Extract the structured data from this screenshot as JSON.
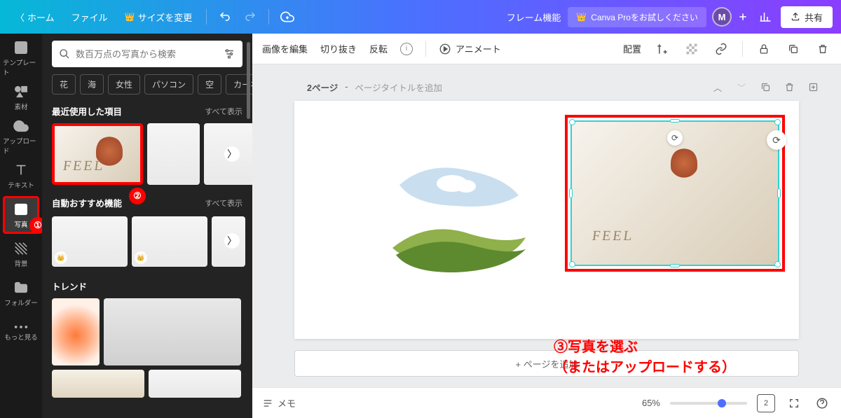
{
  "topbar": {
    "home": "ホーム",
    "file": "ファイル",
    "resize": "サイズを変更",
    "title": "フレーム機能",
    "pro": "Canva Proをお試しください",
    "avatar": "M",
    "share": "共有"
  },
  "rail": {
    "items": [
      {
        "id": "template",
        "label": "テンプレート"
      },
      {
        "id": "elements",
        "label": "素材"
      },
      {
        "id": "upload",
        "label": "アップロード"
      },
      {
        "id": "text",
        "label": "テキスト"
      },
      {
        "id": "photos",
        "label": "写真"
      },
      {
        "id": "background",
        "label": "背景"
      },
      {
        "id": "folder",
        "label": "フォルダー"
      },
      {
        "id": "more",
        "label": "もっと見る"
      }
    ]
  },
  "panel": {
    "search_placeholder": "数百万点の写真から検索",
    "tags": [
      "花",
      "海",
      "女性",
      "パソコン",
      "空",
      "カーネ"
    ],
    "sections": {
      "recent": {
        "title": "最近使用した項目",
        "more": "すべて表示"
      },
      "auto": {
        "title": "自動おすすめ機能",
        "more": "すべて表示"
      },
      "trend": {
        "title": "トレンド"
      }
    }
  },
  "context": {
    "edit_image": "画像を編集",
    "crop": "切り抜き",
    "flip": "反転",
    "animate": "アニメート",
    "position": "配置"
  },
  "page": {
    "label": "2ページ",
    "title_placeholder": "ページタイトルを追加",
    "add_page": "+ ページを追加"
  },
  "annotation": {
    "line1": "③写真を選ぶ",
    "line2": "（またはアップロードする）",
    "badge1": "①",
    "badge2": "②"
  },
  "bottom": {
    "memo": "メモ",
    "zoom": "65%",
    "page_indicator": "2"
  },
  "colors": {
    "highlight": "#f00",
    "selection": "#2fd3d3"
  }
}
